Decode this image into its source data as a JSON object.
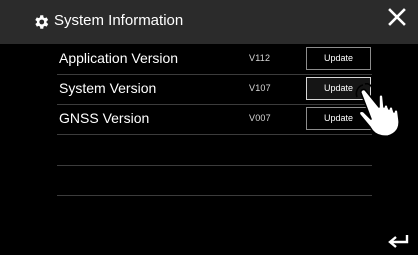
{
  "header": {
    "title": "System Information",
    "icon": "gear-icon",
    "close_icon": "close-icon"
  },
  "rows": [
    {
      "label": "Application Version",
      "version": "V112",
      "button": "Update"
    },
    {
      "label": "System Version",
      "version": "V107",
      "button": "Update"
    },
    {
      "label": "GNSS Version",
      "version": "V007",
      "button": "Update"
    }
  ],
  "footer": {
    "back_icon": "back-arrow-icon"
  },
  "overlay": {
    "hand_icon": "pointing-hand-icon"
  },
  "colors": {
    "background": "#000000",
    "header_background": "#2b2b2b",
    "text": "#ffffff",
    "divider": "#3c3c3c",
    "button_border": "#8c8c8c"
  }
}
